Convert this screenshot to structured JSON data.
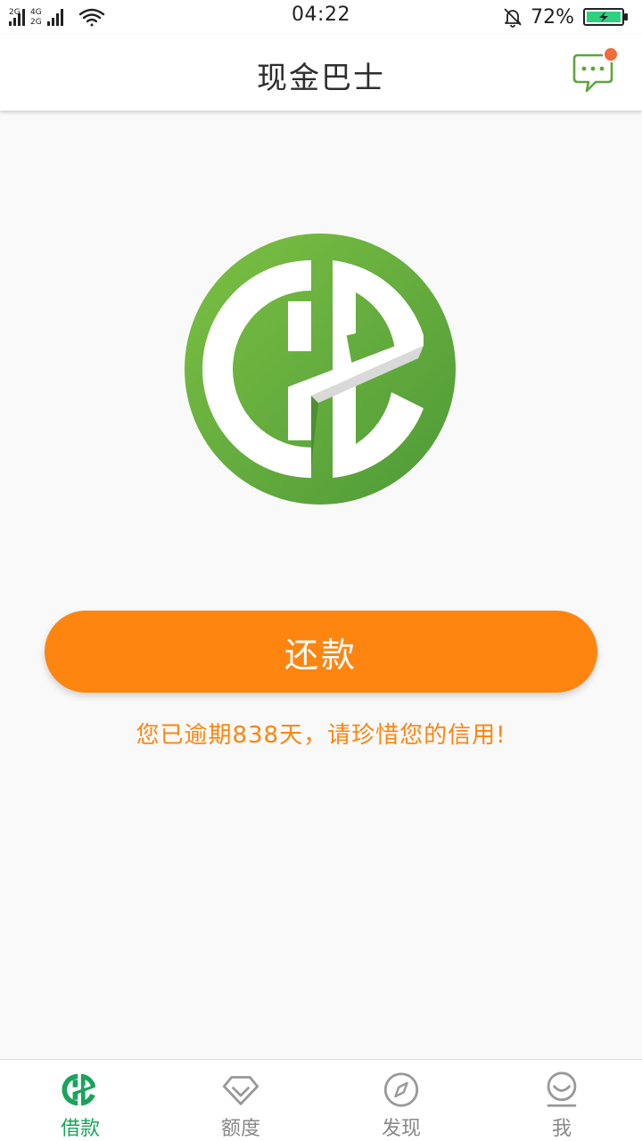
{
  "status_bar": {
    "signal_1_type": "2G",
    "signal_2_type_top": "4G",
    "signal_2_type_bottom": "2G",
    "time": "04:22",
    "battery_percent": "72%",
    "icons": [
      "signal-icon",
      "wifi-icon",
      "bell-muted-icon",
      "battery-charging-icon"
    ]
  },
  "header": {
    "title": "现金巴士",
    "message_icon": "chat-bubble-icon",
    "has_unread": true
  },
  "main": {
    "logo_icon": "cash-bus-logo",
    "repay_button_label": "还款",
    "overdue_notice": "您已逾期838天，请珍惜您的信用!"
  },
  "tabs": [
    {
      "label": "借款",
      "icon": "cash-bus-logo-icon",
      "active": true
    },
    {
      "label": "额度",
      "icon": "diamond-icon",
      "active": false
    },
    {
      "label": "发现",
      "icon": "compass-icon",
      "active": false
    },
    {
      "label": "我",
      "icon": "smiley-user-icon",
      "active": false
    }
  ],
  "colors": {
    "brand_green": "#5ea53d",
    "accent_orange": "#fd8510",
    "active_tab_green": "#1aa35c",
    "badge_red": "#f26b3a"
  }
}
